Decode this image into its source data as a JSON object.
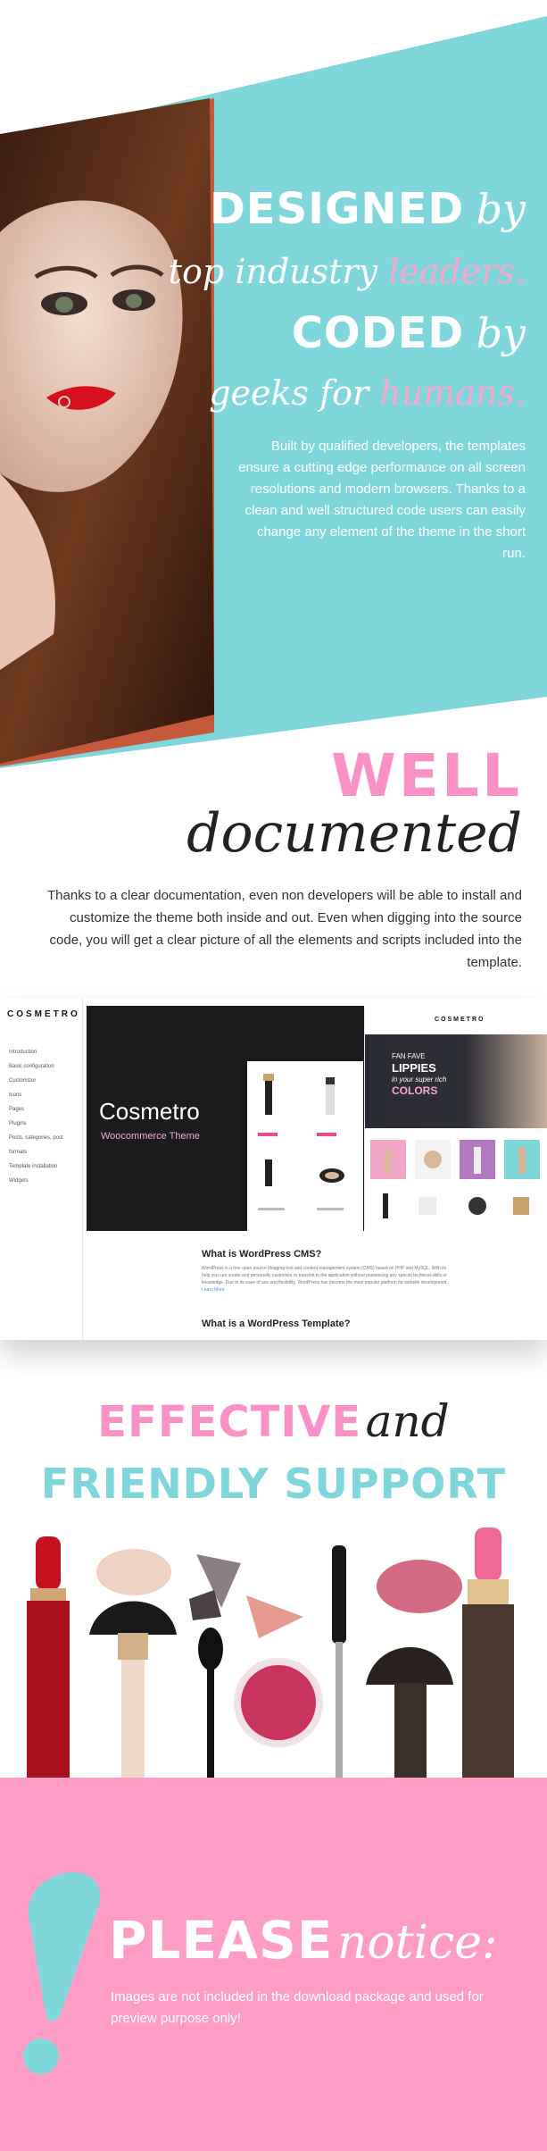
{
  "colors": {
    "teal": "#7fd7dc",
    "pink": "#f990c6",
    "light_pink": "#f7a8cd",
    "notice_bg": "#fd9dc6",
    "dark": "#222222"
  },
  "hero": {
    "line1_caps": "DESIGNED",
    "line1_italic": "by",
    "line2_a": "top industry ",
    "line2_b": "leaders.",
    "line3_caps": "CODED",
    "line3_italic": "by",
    "line4_a": "geeks for ",
    "line4_b": "humans.",
    "paragraph": "Built by qualified developers,  the templates ensure a cutting edge performance on all screen resolutions and modern browsers. Thanks to a clean and well structured code users can easily change any element of the theme in the short run."
  },
  "documentation": {
    "title_caps": "WELL",
    "title_italic": "documented",
    "paragraph": "Thanks to a clear documentation, even non developers will be able to install and customize the theme both inside and out. Even when digging into the source code, you will get a clear picture of all the elements and scripts included into the template."
  },
  "doc_screenshot": {
    "logo": "COSMETRO",
    "menu": [
      "Introduction",
      "Basic configuration",
      "Customizer",
      "Icons",
      "Pages",
      "Plugins",
      "Posts, categories, post formats",
      "Template installation",
      "Widgets"
    ],
    "hero_title": "Cosmetro",
    "hero_subtitle": "Woocommerce Theme",
    "store_logo": "COSMETRO",
    "banner_line1": "FAN FAVE",
    "banner_line2": "LIPPIES",
    "banner_line3": "in your super rich",
    "banner_line4": "COLORS",
    "heading1": "What is WordPress CMS?",
    "paragraph": "WordPress is a free open source blogging tool and content management system (CMS) based on PHP and MySQL. With its help you can create and personally customize or transmit to the application without possessing any special technical skills or knowledge. Due to its ease of use and flexibility, WordPress has become the most popular platform for website development.",
    "read_more": "Learn More",
    "heading2": "What is a WordPress Template?"
  },
  "support": {
    "line1_caps": "EFFECTIVE",
    "line1_italic": "and",
    "line2_caps": "FRIENDLY SUPPORT"
  },
  "notice": {
    "caps": "PLEASE",
    "italic": "notice:",
    "paragraph": "Images are not included in the download package and used for preview purpose only!"
  }
}
